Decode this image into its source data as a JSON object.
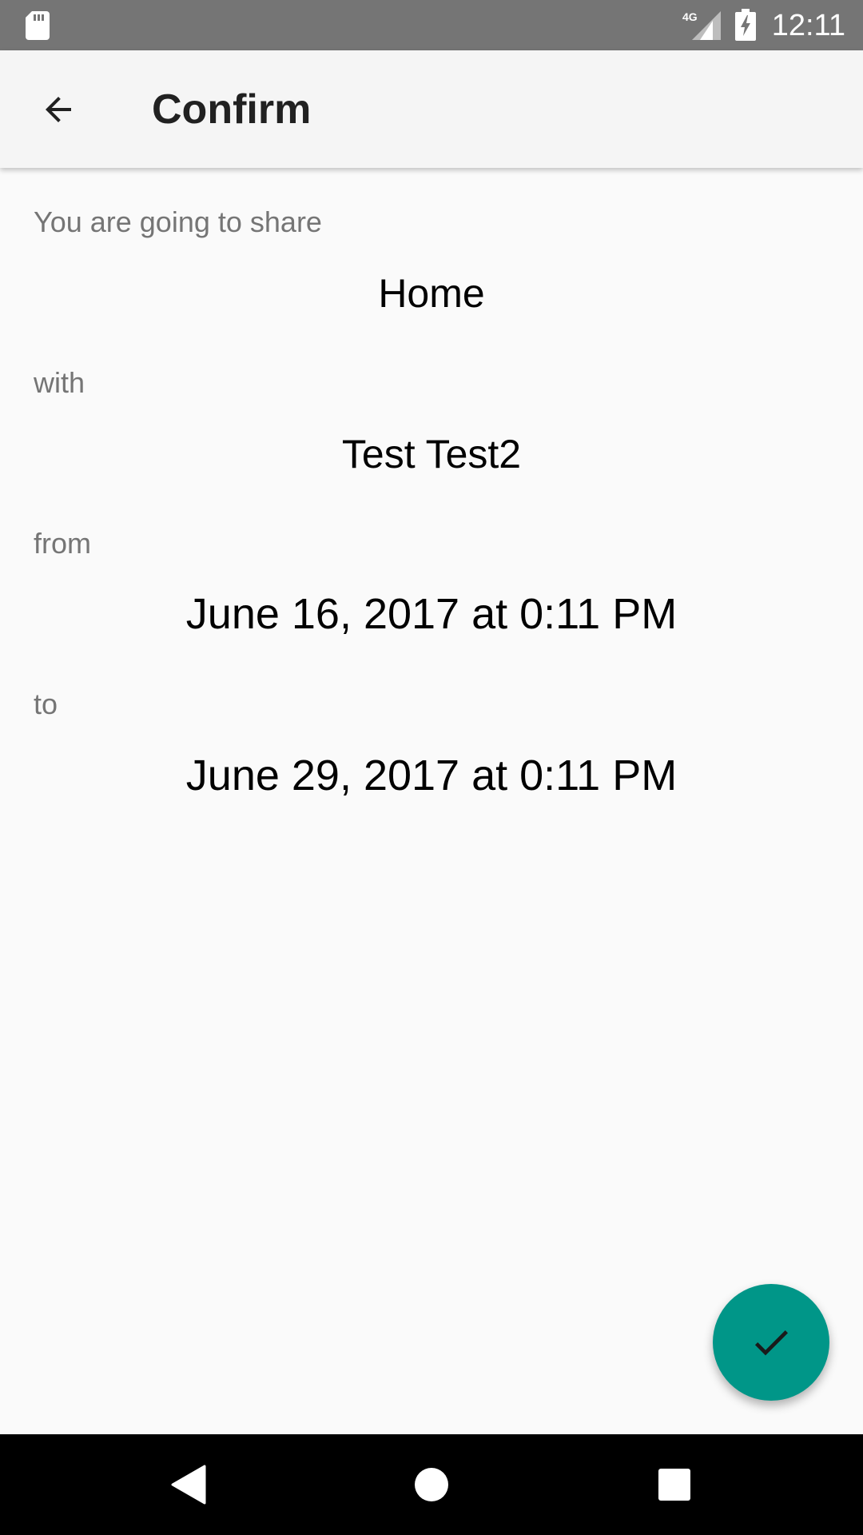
{
  "status_bar": {
    "time": "12:11",
    "network": "4G"
  },
  "app_bar": {
    "title": "Confirm"
  },
  "share": {
    "intro_label": "You are going to share",
    "item": "Home",
    "with_label": "with",
    "recipient": "Test Test2",
    "from_label": "from",
    "from_value": "June 16, 2017 at 0:11 PM",
    "to_label": "to",
    "to_value": "June 29, 2017 at 0:11 PM"
  },
  "colors": {
    "accent": "#009688",
    "status_bar": "#757575",
    "app_bar": "#F5F5F5",
    "background": "#FAFAFA"
  },
  "icons": {
    "back": "arrow-back-icon",
    "fab": "check-icon",
    "nav_back": "triangle-back-icon",
    "nav_home": "circle-home-icon",
    "nav_recents": "square-recents-icon"
  }
}
